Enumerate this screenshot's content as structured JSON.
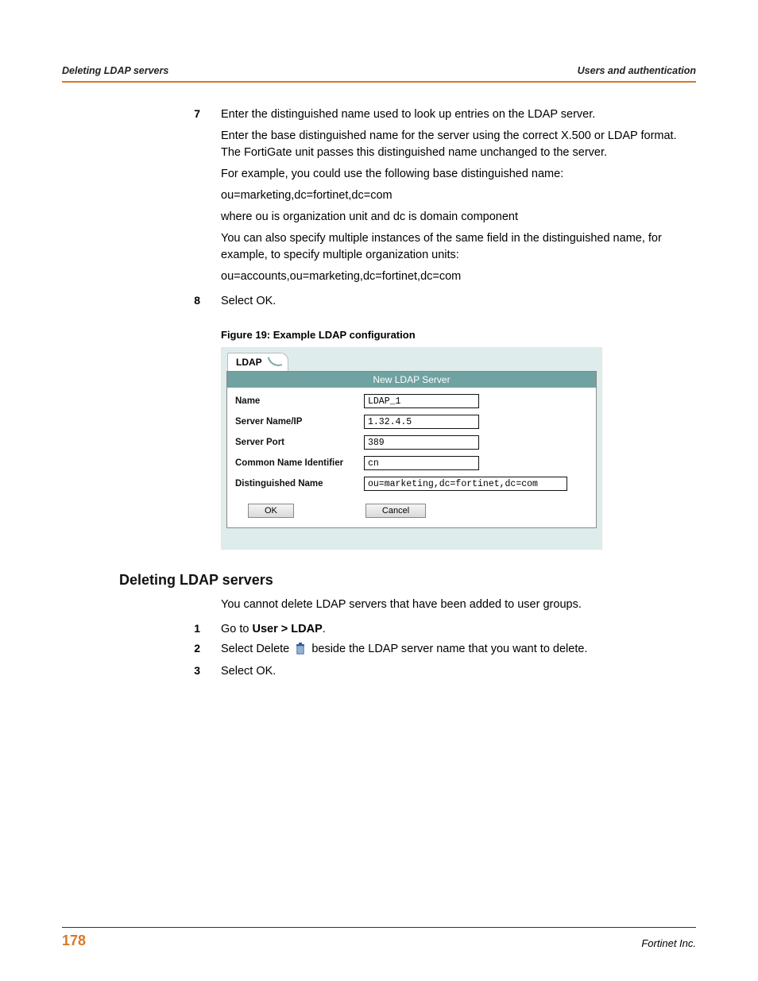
{
  "header": {
    "left": "Deleting LDAP servers",
    "right": "Users and authentication"
  },
  "steps_a": [
    {
      "num": "7",
      "paras": [
        "Enter the distinguished name used to look up entries on the LDAP server.",
        "Enter the base distinguished name for the server using the correct X.500 or LDAP format. The FortiGate unit passes this distinguished name unchanged to the server.",
        "For example, you could use the following base distinguished name:",
        "ou=marketing,dc=fortinet,dc=com",
        "where ou is organization unit and dc is domain component",
        "You can also specify multiple instances of the same field in the distinguished name, for example, to specify multiple organization units:",
        "ou=accounts,ou=marketing,dc=fortinet,dc=com"
      ]
    },
    {
      "num": "8",
      "paras": [
        "Select OK."
      ]
    }
  ],
  "figure": {
    "caption": "Figure 19: Example LDAP configuration",
    "tab": "LDAP",
    "panel_title": "New LDAP Server",
    "fields": {
      "name_label": "Name",
      "name_value": "LDAP_1",
      "server_label": "Server Name/IP",
      "server_value": "1.32.4.5",
      "port_label": "Server Port",
      "port_value": "389",
      "cn_label": "Common Name Identifier",
      "cn_value": "cn",
      "dn_label": "Distinguished Name",
      "dn_value": "ou=marketing,dc=fortinet,dc=com"
    },
    "ok": "OK",
    "cancel": "Cancel"
  },
  "section": {
    "heading": "Deleting LDAP servers",
    "intro": "You cannot delete LDAP servers that have been added to user groups.",
    "steps": [
      {
        "num": "1",
        "pre": "Go to ",
        "bold": "User > LDAP",
        "post": "."
      },
      {
        "num": "2",
        "pre": "Select Delete ",
        "post_after_icon": " beside the LDAP server name that you want to delete."
      },
      {
        "num": "3",
        "text": "Select OK."
      }
    ]
  },
  "footer": {
    "page": "178",
    "company": "Fortinet Inc."
  }
}
